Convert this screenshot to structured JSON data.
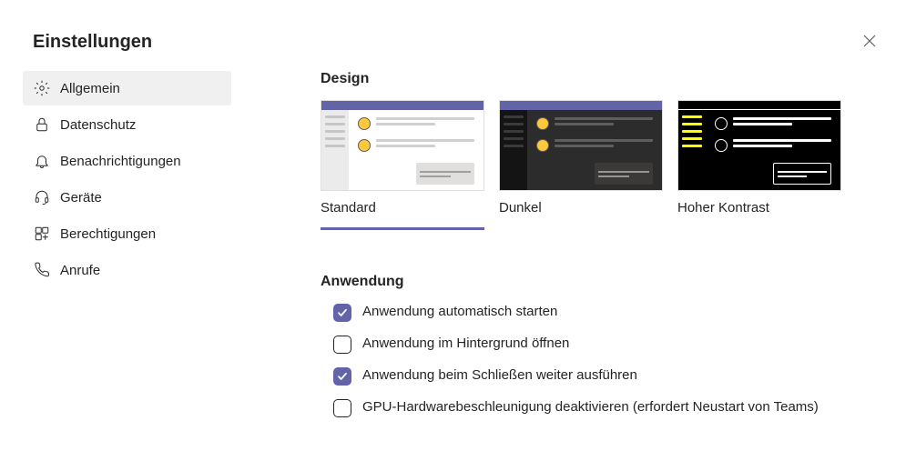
{
  "title": "Einstellungen",
  "sidebar": {
    "items": [
      {
        "label": "Allgemein"
      },
      {
        "label": "Datenschutz"
      },
      {
        "label": "Benachrichtigungen"
      },
      {
        "label": "Geräte"
      },
      {
        "label": "Berechtigungen"
      },
      {
        "label": "Anrufe"
      }
    ]
  },
  "design": {
    "heading": "Design",
    "themes": [
      {
        "label": "Standard"
      },
      {
        "label": "Dunkel"
      },
      {
        "label": "Hoher Kontrast"
      }
    ]
  },
  "application": {
    "heading": "Anwendung",
    "options": [
      {
        "label": "Anwendung automatisch starten",
        "checked": true
      },
      {
        "label": "Anwendung im Hintergrund öffnen",
        "checked": false
      },
      {
        "label": "Anwendung beim Schließen weiter ausführen",
        "checked": true
      },
      {
        "label": "GPU-Hardwarebeschleunigung deaktivieren (erfordert Neustart von Teams)",
        "checked": false
      }
    ]
  }
}
